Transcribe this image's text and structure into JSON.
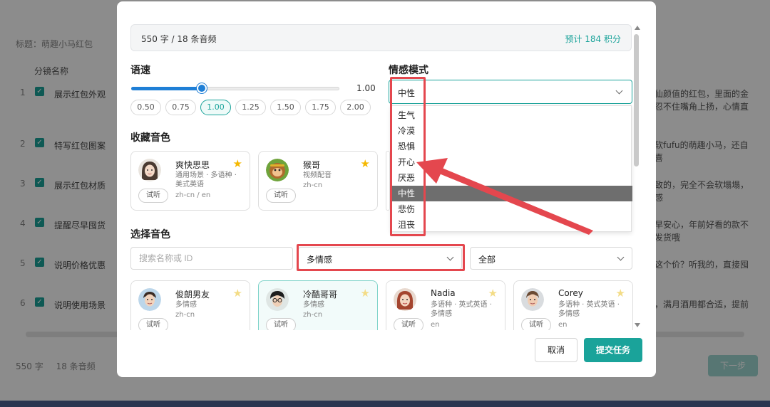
{
  "background": {
    "title": "标题：萌趣小马红包",
    "column_header": "分镜名称",
    "rows": [
      {
        "num": "1",
        "name": "展示红包外观",
        "right": "仙颜值的红包，里面的金 忍不住嘴角上扬，心情直"
      },
      {
        "num": "2",
        "name": "特写红包图案",
        "right": "软fufu的萌趣小马，还自 喜"
      },
      {
        "num": "3",
        "name": "展示红包材质",
        "right": "致的，完全不会软塌塌， 感"
      },
      {
        "num": "4",
        "name": "提醒尽早囤货",
        "right": "早安心，年前好看的款不 发货哦"
      },
      {
        "num": "5",
        "name": "说明价格优惠",
        "right": "这个价？听我的，直接囤"
      },
      {
        "num": "6",
        "name": "说明使用场景",
        "right": "，满月酒用都合适，提前"
      }
    ],
    "footer_chars": "550 字",
    "footer_audio": "18 条音频",
    "next_button": "下一步"
  },
  "summary": {
    "left": "550 字 / 18 条音频",
    "right": "预计 184 积分"
  },
  "speed": {
    "title": "语速",
    "value": "1.00",
    "fraction": 0.34,
    "presets": [
      "0.50",
      "0.75",
      "1.00",
      "1.25",
      "1.50",
      "1.75",
      "2.00"
    ],
    "active_preset": "1.00"
  },
  "emotion": {
    "title": "情感模式",
    "selected": "中性",
    "options": [
      "生气",
      "冷漠",
      "恐惧",
      "开心",
      "厌恶",
      "中性",
      "悲伤",
      "沮丧"
    ]
  },
  "favorites": {
    "title": "收藏音色",
    "cards": [
      {
        "name": "爽快思思",
        "desc": "通用场景 · 多语种 · 美式英语",
        "lang": "zh-cn / en",
        "listen": "试听",
        "starred": true
      },
      {
        "name": "猴哥",
        "desc": "视频配音",
        "lang": "zh-cn",
        "listen": "试听",
        "starred": true
      }
    ]
  },
  "voice_select": {
    "title": "选择音色",
    "search_placeholder": "搜索名称或 ID",
    "filter_value": "多情感",
    "filter2_value": "全部",
    "cards": [
      {
        "name": "俊朗男友",
        "desc": "多情感",
        "lang": "zh-cn",
        "listen": "试听",
        "starred": false
      },
      {
        "name": "冷酷哥哥",
        "desc": "多情感",
        "lang": "zh-cn",
        "listen": "试听",
        "starred": false
      },
      {
        "name": "Nadia",
        "desc": "多语种 · 英式英语 · 多情感",
        "lang": "en",
        "listen": "试听",
        "starred": false
      },
      {
        "name": "Corey",
        "desc": "多语种 · 英式英语 · 多情感",
        "lang": "en",
        "listen": "试听",
        "starred": false
      }
    ]
  },
  "footer": {
    "cancel": "取消",
    "submit": "提交任务"
  },
  "colors": {
    "accent": "#1aa39a",
    "slider": "#1f7fd6",
    "highlight": "#e4474e",
    "star": "#f5b800"
  }
}
